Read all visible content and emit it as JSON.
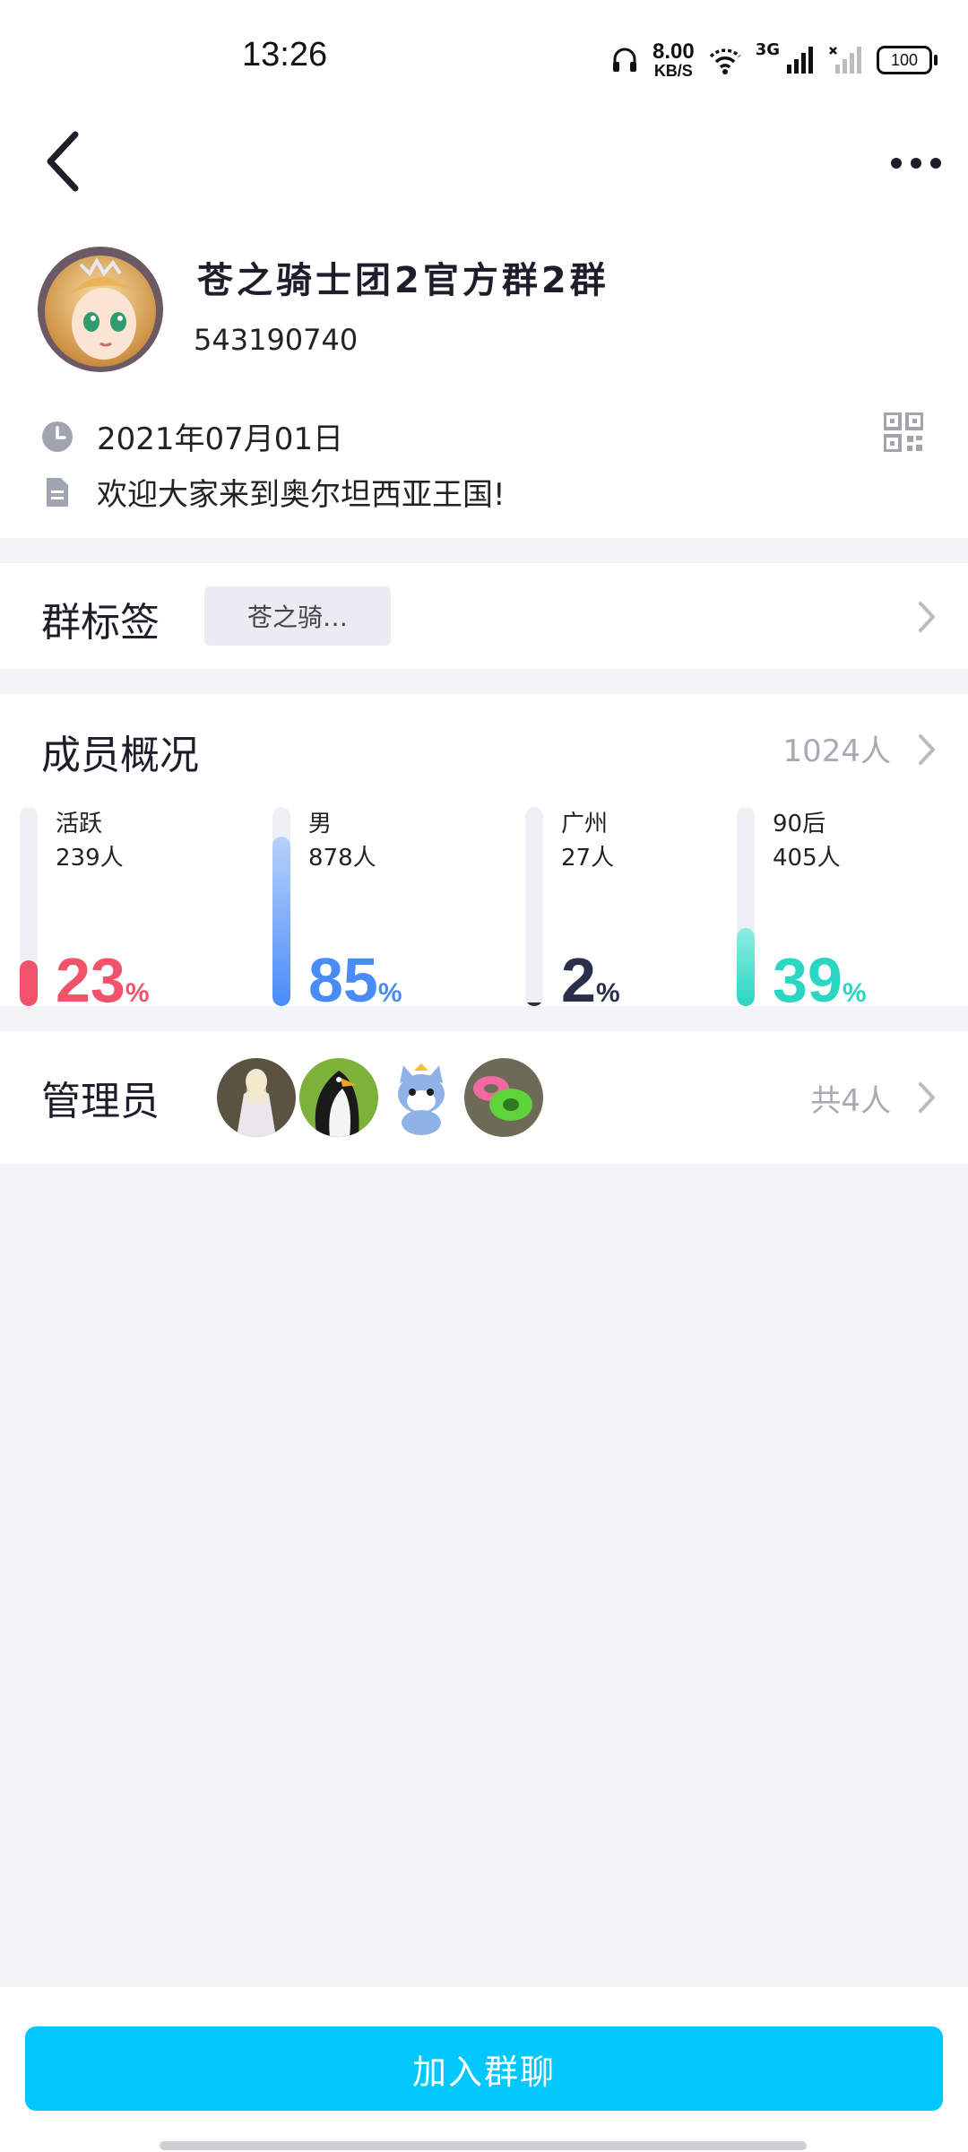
{
  "status_bar": {
    "time": "13:26",
    "speed_value": "8.00",
    "speed_unit": "KB/S",
    "network": "3G",
    "battery": "100"
  },
  "header": {
    "back_icon": "chevron-left-icon",
    "more_icon": "more-dots-icon"
  },
  "profile": {
    "name": "苍之骑士团2官方群2群",
    "group_id": "543190740",
    "created_date": "2021年07月01日",
    "intro": "欢迎大家来到奥尔坦西亚王国!"
  },
  "tags": {
    "title": "群标签",
    "chip": "苍之骑…"
  },
  "members": {
    "title": "成员概况",
    "count": "1024人",
    "stats": [
      {
        "label": "活跃",
        "sub": "239人",
        "percent": 23,
        "color": "#F2536A",
        "fill_top": "#F2536A",
        "fill_bottom": "#F2536A"
      },
      {
        "label": "男",
        "sub": "878人",
        "percent": 85,
        "color": "#4A8CF7",
        "fill_top": "#B7D1FB",
        "fill_bottom": "#4A8CF7"
      },
      {
        "label": "广州",
        "sub": "27人",
        "percent": 2,
        "color": "#2A3049",
        "fill_top": "#2A3049",
        "fill_bottom": "#2A3049"
      },
      {
        "label": "90后",
        "sub": "405人",
        "percent": 39,
        "color": "#2BD6C3",
        "fill_top": "#8DEDE0",
        "fill_bottom": "#2BD6C3"
      }
    ],
    "percent_sign": "%"
  },
  "admins": {
    "title": "管理员",
    "count": "共4人",
    "avatars": [
      "admin-avatar-white-robed",
      "admin-avatar-penguin",
      "admin-avatar-cat",
      "admin-avatar-rings"
    ]
  },
  "bottom": {
    "join_label": "加入群聊"
  },
  "colors": {
    "accent": "#00C7FC",
    "background": "#F3F4F8"
  }
}
